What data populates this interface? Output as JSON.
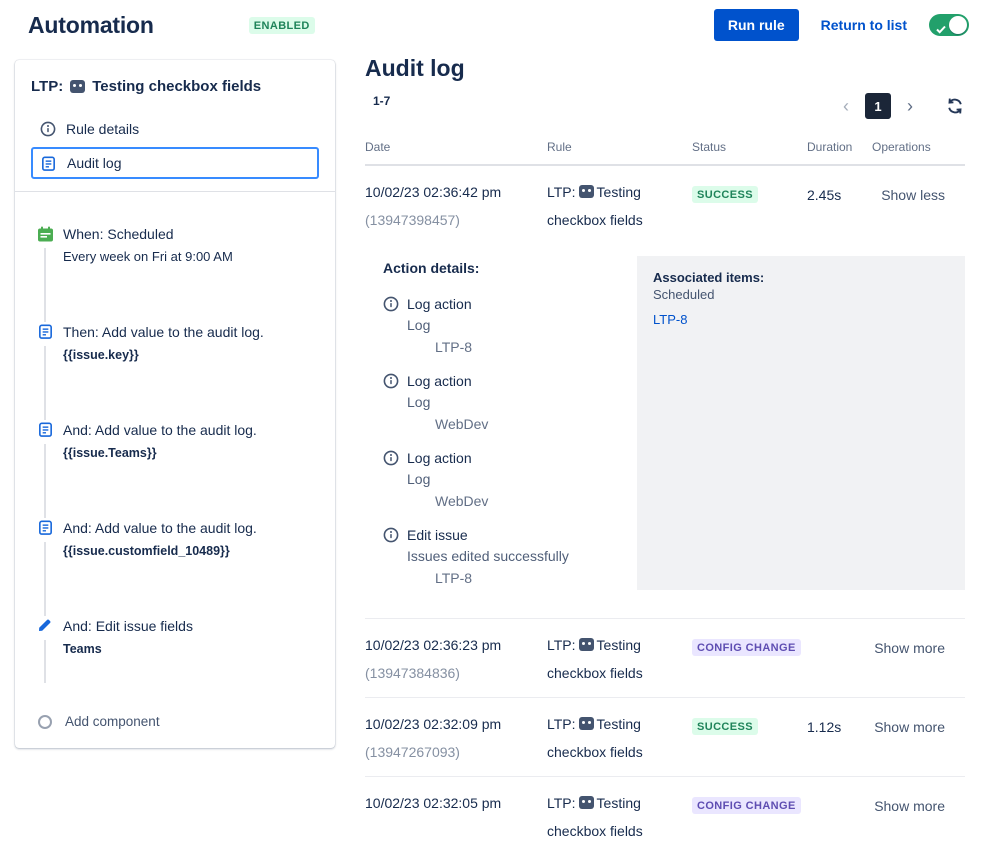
{
  "header": {
    "title": "Automation",
    "status_badge": "ENABLED",
    "run_rule": "Run rule",
    "return_to_list": "Return to list"
  },
  "icons": {
    "prev": "‹",
    "next": "›"
  },
  "sidebar": {
    "rule_key": "LTP:",
    "rule_name": "Testing checkbox fields",
    "nav_rule_details": "Rule details",
    "nav_audit_log": "Audit log",
    "components": [
      {
        "title": "When: Scheduled",
        "subtitle": "Every week on Fri at 9:00 AM"
      },
      {
        "title": "Then: Add value to the audit log.",
        "subtitle": "{{issue.key}}"
      },
      {
        "title": "And: Add value to the audit log.",
        "subtitle": "{{issue.Teams}}"
      },
      {
        "title": "And: Add value to the audit log.",
        "subtitle": "{{issue.customfield_10489}}"
      },
      {
        "title": "And: Edit issue fields",
        "subtitle": "Teams"
      }
    ],
    "add_component": "Add component"
  },
  "audit": {
    "title": "Audit log",
    "range": "1-7",
    "page": "1",
    "columns": [
      "Date",
      "Rule",
      "Status",
      "Duration",
      "Operations"
    ],
    "rows": [
      {
        "date": "10/02/23 02:36:42 pm",
        "id": "(13947398457)",
        "rule_key": "LTP:",
        "rule_name": "Testing checkbox fields",
        "status": "SUCCESS",
        "duration": "2.45s",
        "operation": "Show less"
      },
      {
        "date": "10/02/23 02:36:23 pm",
        "id": "(13947384836)",
        "rule_key": "LTP:",
        "rule_name": "Testing checkbox fields",
        "status": "CONFIG CHANGE",
        "duration": "",
        "operation": "Show more"
      },
      {
        "date": "10/02/23 02:32:09 pm",
        "id": "(13947267093)",
        "rule_key": "LTP:",
        "rule_name": "Testing checkbox fields",
        "status": "SUCCESS",
        "duration": "1.12s",
        "operation": "Show more"
      },
      {
        "date": "10/02/23 02:32:05 pm",
        "id": "",
        "rule_key": "LTP:",
        "rule_name": "Testing checkbox fields",
        "status": "CONFIG CHANGE",
        "duration": "",
        "operation": "Show more"
      }
    ],
    "details": {
      "heading": "Action details:",
      "actions": [
        {
          "title": "Log action",
          "line1": "Log",
          "line2": "LTP-8"
        },
        {
          "title": "Log action",
          "line1": "Log",
          "line2": "WebDev"
        },
        {
          "title": "Log action",
          "line1": "Log",
          "line2": "WebDev"
        },
        {
          "title": "Edit issue",
          "line1": "Issues edited successfully",
          "line2": "LTP-8"
        }
      ],
      "associated": {
        "heading": "Associated items:",
        "trigger": "Scheduled",
        "item": "LTP-8"
      }
    }
  },
  "colors": {
    "primary_blue": "#0052CC",
    "success_bg": "#DCFCEA",
    "success_text": "#1F845A",
    "config_bg": "#EAE6FF",
    "config_text": "#5E4DB2",
    "toggle_green": "#22A06B",
    "heading_navy": "#172B4D"
  }
}
